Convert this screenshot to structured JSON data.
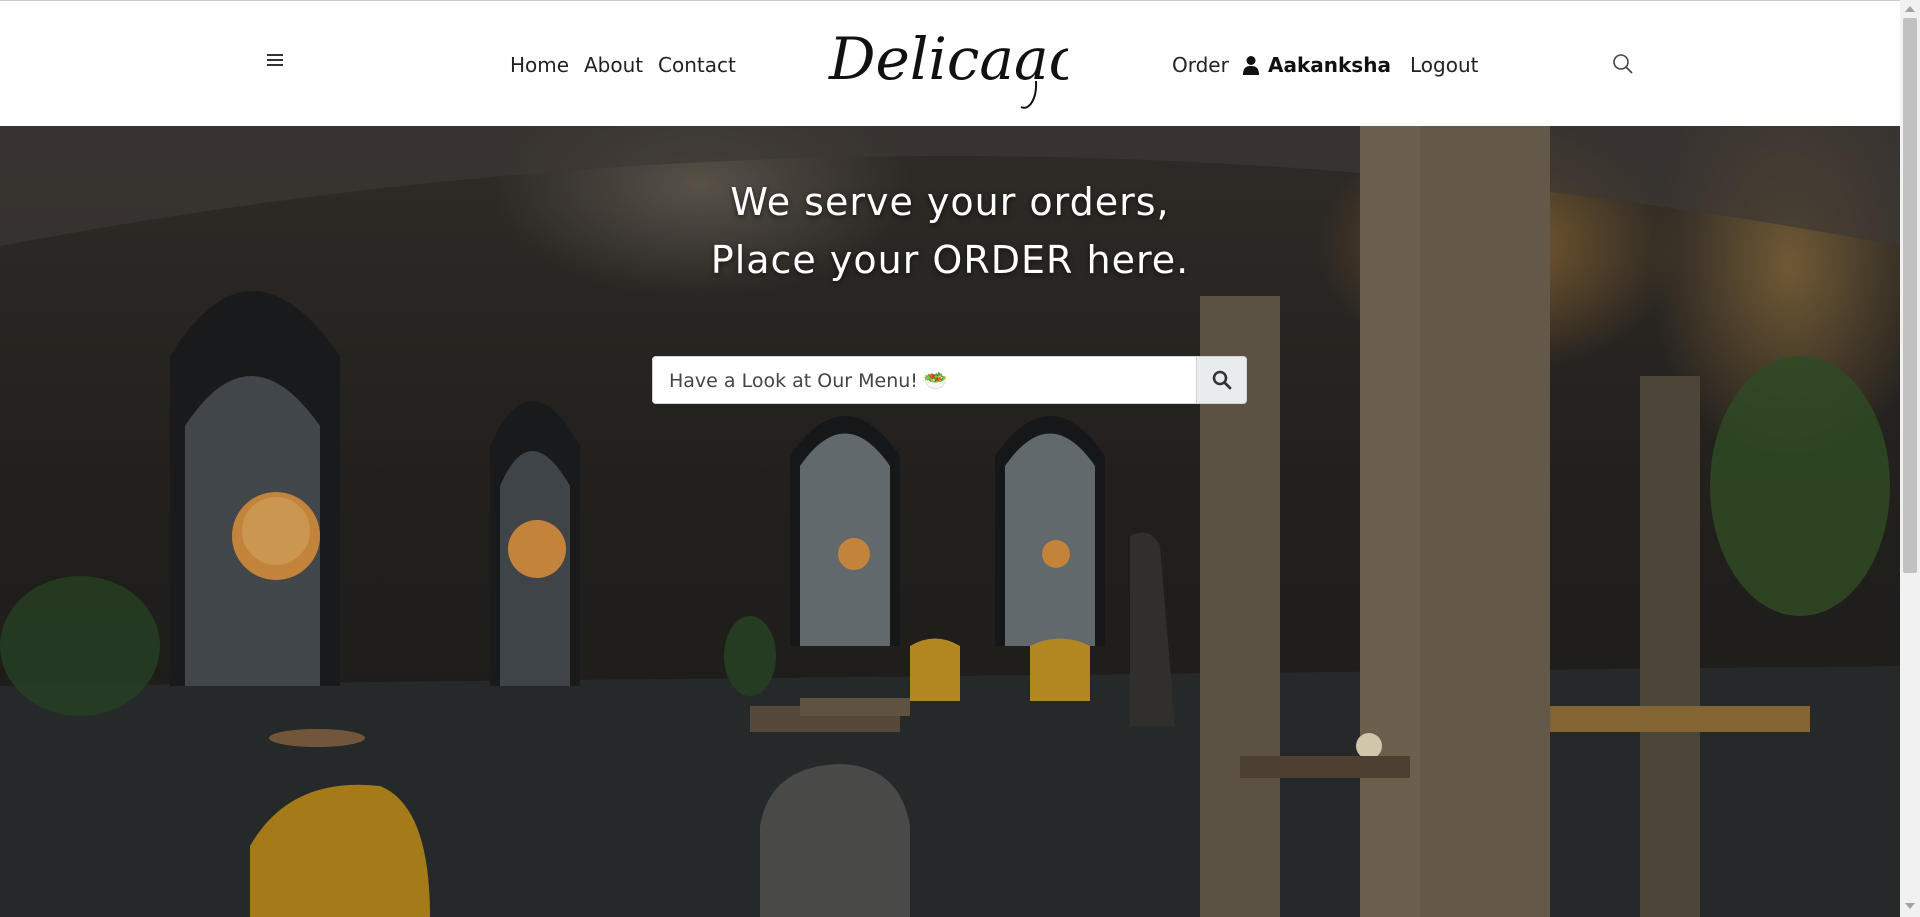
{
  "header": {
    "nav_left": [
      "Home",
      "About",
      "Contact"
    ],
    "brand": "Delicaacy",
    "order_label": "Order",
    "user_name": "Aakanksha",
    "logout_label": "Logout"
  },
  "hero": {
    "headline_line1": "We serve your orders,",
    "headline_line2": "Place your ORDER here."
  },
  "search": {
    "placeholder": "Have a Look at Our Menu! 🥗"
  },
  "icons": {
    "menu": "hamburger-icon",
    "user": "user-icon",
    "search": "search-icon"
  },
  "colors": {
    "header_bg": "#ffffff",
    "hero_text": "#ffffff",
    "search_button_bg": "#e9ecef"
  }
}
